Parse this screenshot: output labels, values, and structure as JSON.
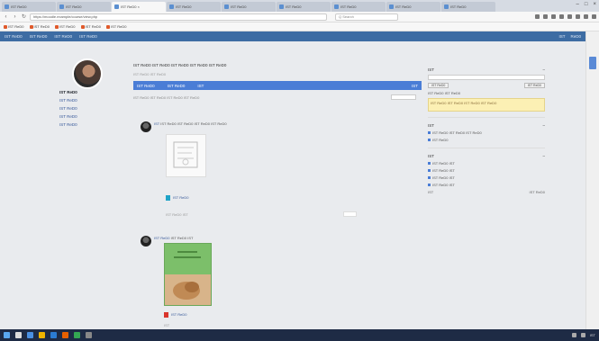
{
  "browser": {
    "tabs": [
      {
        "label": "IST ReD0"
      },
      {
        "label": "IST ReD0"
      },
      {
        "label": "IST ReD0 ×",
        "active": true
      },
      {
        "label": "IST ReD0"
      },
      {
        "label": "IST ReD0"
      },
      {
        "label": "IST ReD0"
      },
      {
        "label": "IST ReD0"
      },
      {
        "label": "IST ReD0"
      },
      {
        "label": "IST ReD0"
      }
    ],
    "window_controls": [
      "–",
      "□",
      "×"
    ],
    "url": "https://moodle.example/course/view.php",
    "search_placeholder": "Q Search",
    "bookmarks": [
      "IST ReD0",
      "IST ReD0",
      "IST ReD0",
      "IST ReD0",
      "IST ReD0"
    ]
  },
  "site_nav": {
    "brand": "IST ReD0",
    "items": [
      "IST ReD0",
      "IST ReD0",
      "IST ReD0"
    ],
    "right_items": [
      "IST",
      "ReD0"
    ]
  },
  "sidebar": {
    "items": [
      "IST ReD0",
      "IST ReD0",
      "IST ReD0",
      "IST ReD0",
      "IST ReD0"
    ]
  },
  "main": {
    "headline": "IST ReD0 IST ReD0 IST ReD0 IST ReD0 IST ReD0",
    "subhead": "IST ReD0 IST ReD0",
    "tabs": [
      "IST ReD0",
      "IST ReD0",
      "IST"
    ],
    "tab_right": "IST",
    "filter_text": "IST ReD0 IST ReD0 IST ReD0 IST ReD0",
    "posts": [
      {
        "author": "IST",
        "text": "IST ReD0 IST ReD0 IST ReD0 IST ReD0",
        "attachment": "IST ReD0",
        "meta": "IST ReD0 IST"
      },
      {
        "author": "IST ReD0",
        "text": "IST ReD0 IST",
        "attachment": "IST ReD0",
        "meta": "IST"
      }
    ]
  },
  "right_panel": {
    "box1_title": "IST",
    "box1_buttons": [
      "IST ReD0",
      "IST ReD0"
    ],
    "box1_line": "IST ReD0 IST ReD0",
    "warning": "IST ReD0 IST ReD0 IST ReD0 IST ReD0",
    "box2_title": "IST",
    "box2_lines": [
      "IST ReD0 IST ReD0 IST ReD0",
      "IST ReD0"
    ],
    "box3_title": "IST",
    "box3_lines": [
      "IST ReD0 IST",
      "IST ReD0 IST",
      "IST ReD0 IST",
      "IST ReD0 IST"
    ],
    "box3_footer_left": "IST",
    "box3_footer_right": "IST ReD0"
  },
  "taskbar": {
    "time": "IST"
  }
}
